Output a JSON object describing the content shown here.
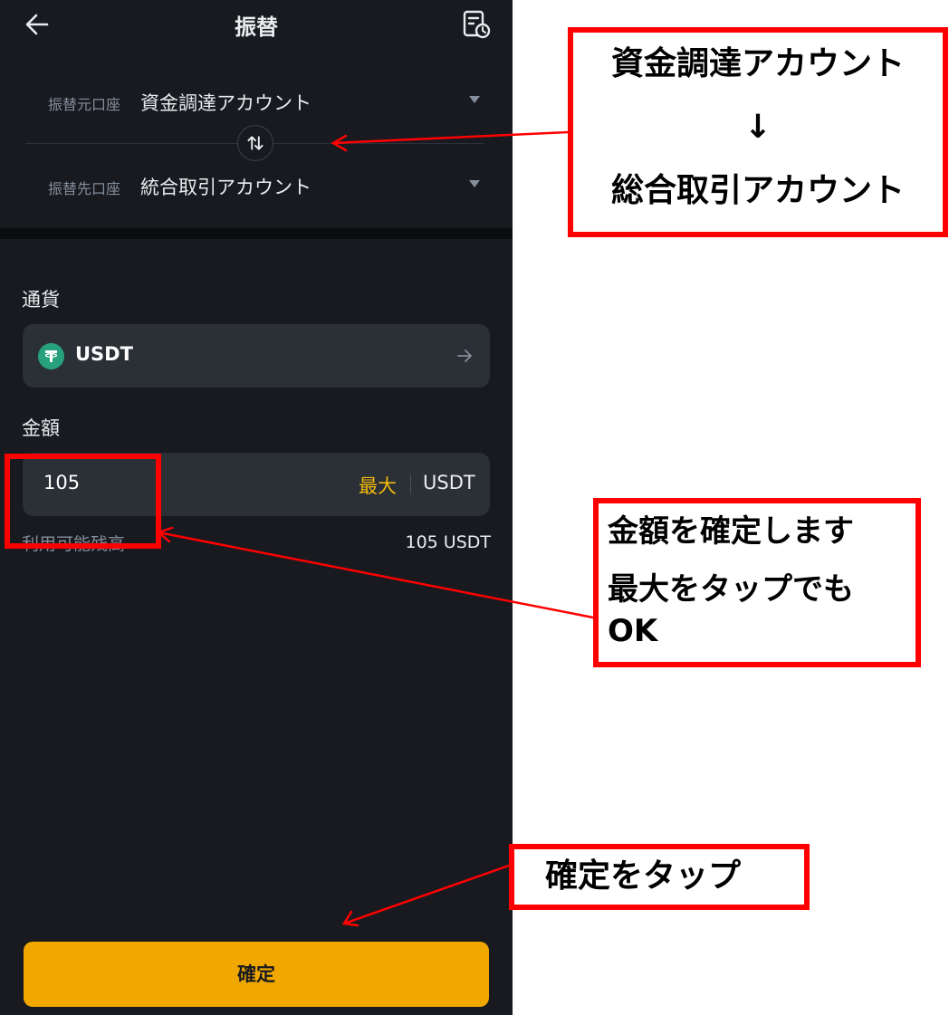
{
  "header": {
    "title": "振替"
  },
  "from_account": {
    "label": "振替元口座",
    "value": "資金調達アカウント"
  },
  "to_account": {
    "label": "振替先口座",
    "value": "統合取引アカウント"
  },
  "currency": {
    "label": "通貨",
    "coin": "USDT",
    "icon": "tether-icon"
  },
  "amount": {
    "label": "金額",
    "value": "105",
    "max_label": "最大",
    "unit": "USDT"
  },
  "available": {
    "label": "利用可能残高",
    "value": "105 USDT"
  },
  "confirm_label": "確定",
  "annotations": {
    "account_note": {
      "line1": "資金調達アカウント",
      "arrow": "↓",
      "line2": "総合取引アカウント"
    },
    "amount_note": {
      "line1": "金額を確定します",
      "line2": "最大をタップでも",
      "line3": "OK"
    },
    "confirm_note": "確定をタップ"
  },
  "colors": {
    "accent": "#f0a800",
    "annotation": "#ff0000",
    "background": "#181a20"
  }
}
